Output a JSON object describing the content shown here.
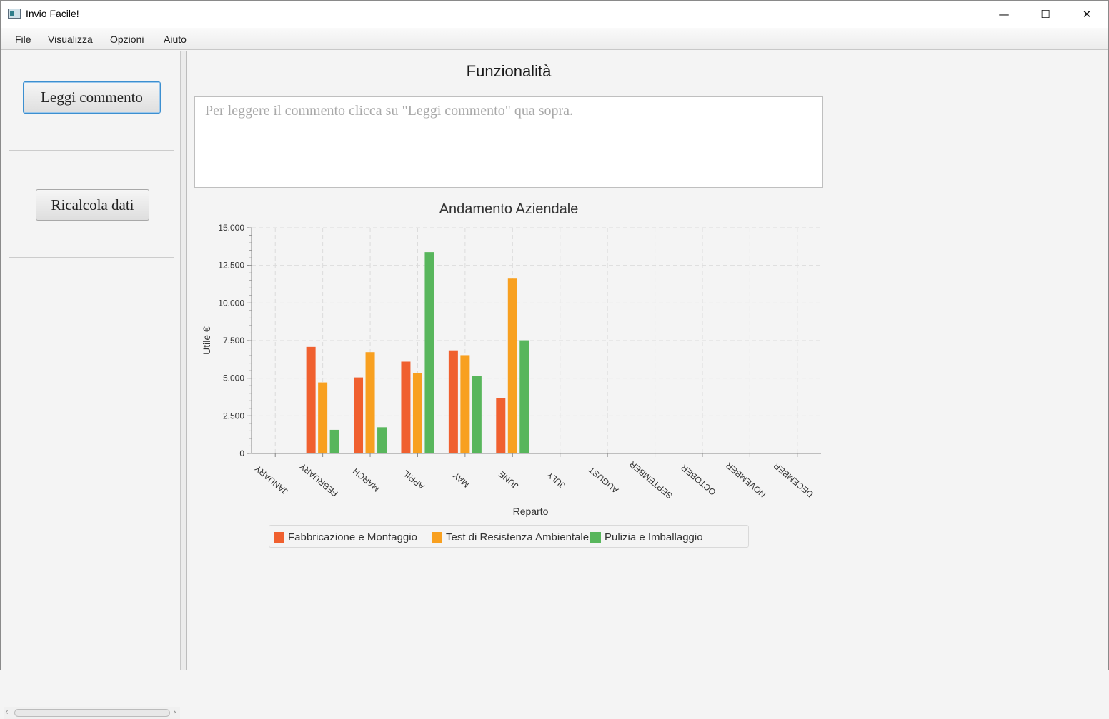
{
  "window": {
    "title": "Invio Facile!",
    "minimize": "—",
    "maximize": "☐",
    "close": "✕"
  },
  "menu": [
    "File",
    "Visualizza",
    "Opzioni",
    "Aiuto"
  ],
  "sidebar": {
    "read_comment": "Leggi commento",
    "recalc": "Ricalcola dati"
  },
  "main": {
    "title": "Funzionalità",
    "comment_placeholder": "Per leggere il commento clicca su \"Leggi commento\" qua sopra."
  },
  "chart_data": {
    "type": "bar",
    "title": "Andamento Aziendale",
    "xlabel": "Reparto",
    "ylabel": "Utile €",
    "ylim": [
      0,
      15000
    ],
    "y_ticks": [
      "0",
      "2.500",
      "5.000",
      "7.500",
      "10.000",
      "12.500",
      "15.000"
    ],
    "y_tick_values": [
      0,
      2500,
      5000,
      7500,
      10000,
      12500,
      15000
    ],
    "categories": [
      "JANUARY",
      "FEBRUARY",
      "MARCH",
      "APRIL",
      "MAY",
      "JUNE",
      "JULY",
      "AUGUST",
      "SEPTEMBER",
      "OCTOBER",
      "NOVEMBER",
      "DECEMBER"
    ],
    "grid": true,
    "legend_position": "bottom",
    "series": [
      {
        "name": "Fabbricazione e Montaggio",
        "color": "#f0602f",
        "values": [
          null,
          7080,
          5050,
          6100,
          6850,
          3680,
          null,
          null,
          null,
          null,
          null,
          null
        ]
      },
      {
        "name": "Test di Resistenza Ambientale",
        "color": "#f8a020",
        "values": [
          null,
          4720,
          6730,
          5350,
          6530,
          11620,
          null,
          null,
          null,
          null,
          null,
          null
        ]
      },
      {
        "name": "Pulizia e Imballaggio",
        "color": "#58b65c",
        "values": [
          null,
          1570,
          1740,
          13380,
          5150,
          7520,
          null,
          null,
          null,
          null,
          null,
          null
        ]
      }
    ]
  }
}
